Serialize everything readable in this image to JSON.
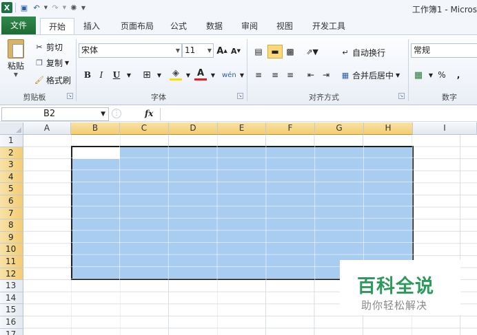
{
  "window": {
    "title": "工作簿1 - Micros"
  },
  "qat": {
    "icons": [
      "excel-logo-icon",
      "save-icon",
      "undo-icon",
      "redo-icon",
      "format-painter-icon"
    ]
  },
  "tabs": [
    {
      "label": "文件"
    },
    {
      "label": "开始"
    },
    {
      "label": "插入"
    },
    {
      "label": "页面布局"
    },
    {
      "label": "公式"
    },
    {
      "label": "数据"
    },
    {
      "label": "审阅"
    },
    {
      "label": "视图"
    },
    {
      "label": "开发工具"
    }
  ],
  "ribbon": {
    "clipboard": {
      "paste": "粘贴",
      "cut": "剪切",
      "copy": "复制",
      "format_painter": "格式刷",
      "label": "剪贴板"
    },
    "font": {
      "name": "宋体",
      "size": "11",
      "bold": "B",
      "italic": "I",
      "underline": "U",
      "label": "字体"
    },
    "alignment": {
      "wrap": "自动换行",
      "merge": "合并后居中",
      "label": "对齐方式"
    },
    "number": {
      "format": "常规",
      "percent": "%",
      "comma": ",",
      "label": "数字"
    }
  },
  "formula_bar": {
    "name_box": "B2",
    "fx": "fx",
    "content": ""
  },
  "sheet": {
    "columns": [
      "A",
      "B",
      "C",
      "D",
      "E",
      "F",
      "G",
      "H",
      "I"
    ],
    "rows": [
      "1",
      "2",
      "3",
      "4",
      "5",
      "6",
      "7",
      "8",
      "9",
      "10",
      "11",
      "12",
      "13",
      "14",
      "15",
      "16",
      "17"
    ],
    "selection": "B2:H12",
    "active_cell": "B2",
    "selection_color": "#a9cdf0"
  },
  "watermark": {
    "title": "百科全说",
    "subtitle": "助你轻松解决",
    "color": "#2c9a5b"
  }
}
